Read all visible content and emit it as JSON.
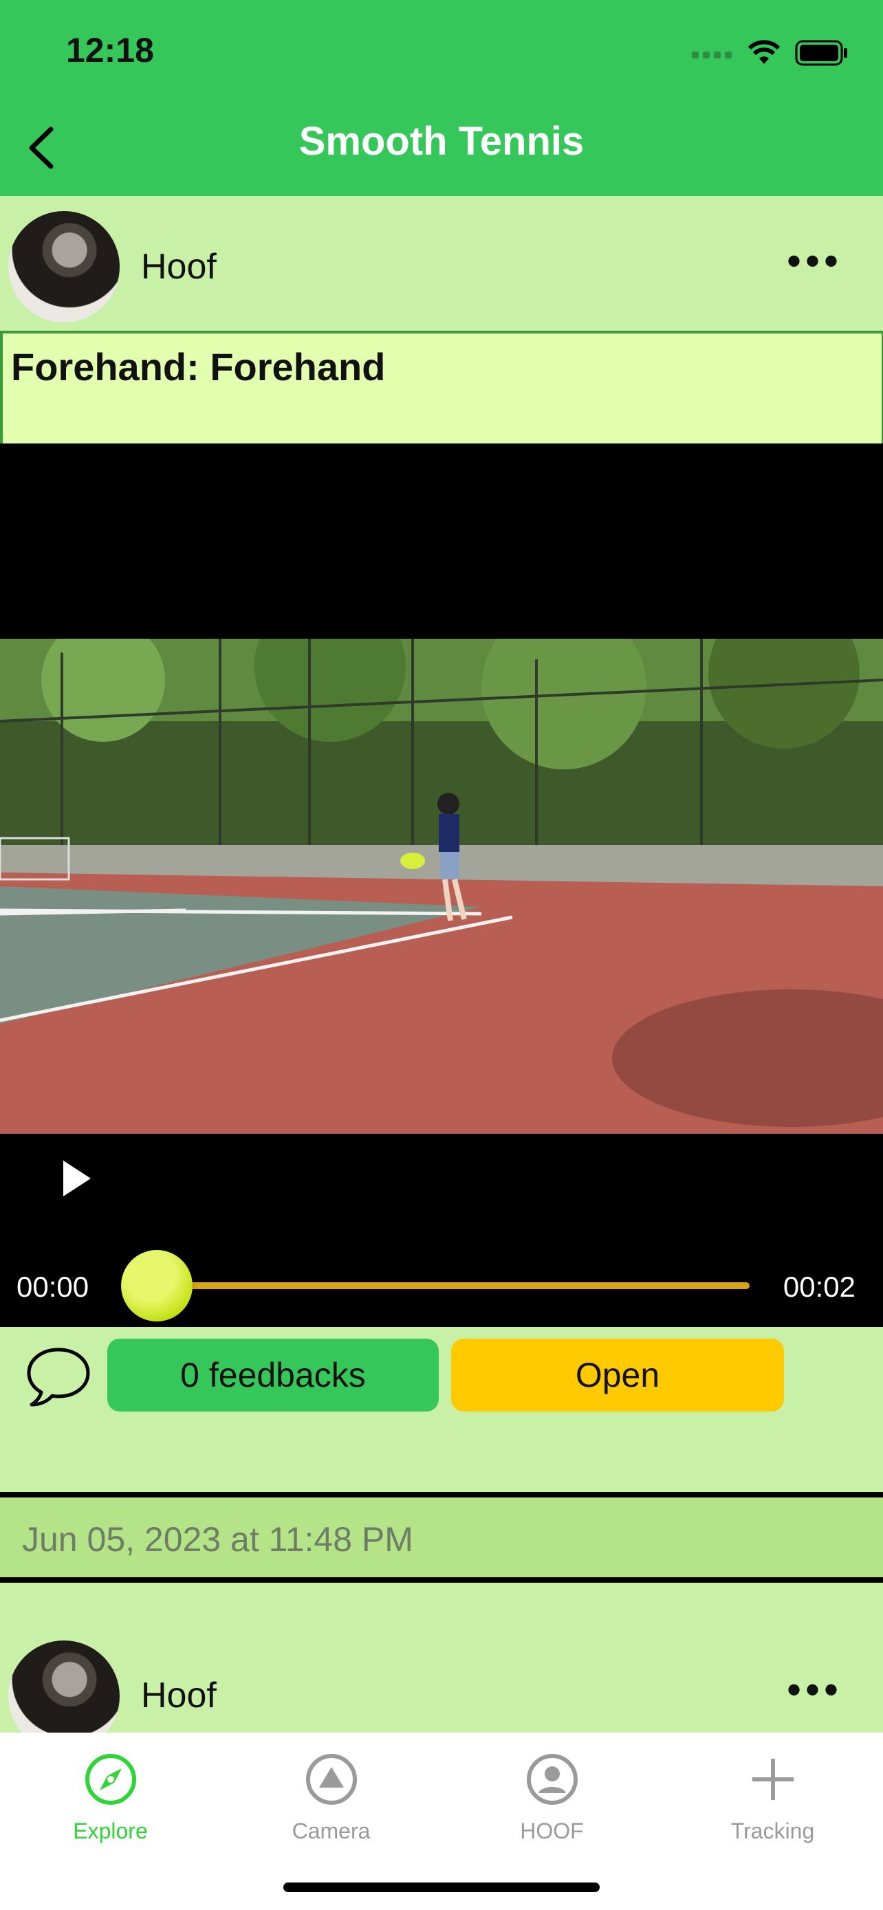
{
  "status_bar": {
    "time": "12:18"
  },
  "nav": {
    "title": "Smooth Tennis"
  },
  "posts": [
    {
      "username": "Hoof",
      "title": "Forehand: Forehand",
      "video": {
        "elapsed": "00:00",
        "duration": "00:02",
        "progress": 0.0
      },
      "feedback_label": "0 feedbacks",
      "status_label": "Open",
      "date": "Jun 05, 2023 at 11:48 PM"
    },
    {
      "username": "Hoof"
    }
  ],
  "tabbar": {
    "items": [
      {
        "label": "Explore",
        "icon": "compass-icon",
        "active": true
      },
      {
        "label": "Camera",
        "icon": "triangle-circle-icon",
        "active": false
      },
      {
        "label": "HOOF",
        "icon": "person-circle-icon",
        "active": false
      },
      {
        "label": "Tracking",
        "icon": "plus-icon",
        "active": false
      }
    ]
  },
  "colors": {
    "header_green": "#36c75a",
    "content_bg": "#c8f0a6",
    "open_button": "#ffcb00",
    "active_tab": "#2fd437"
  }
}
